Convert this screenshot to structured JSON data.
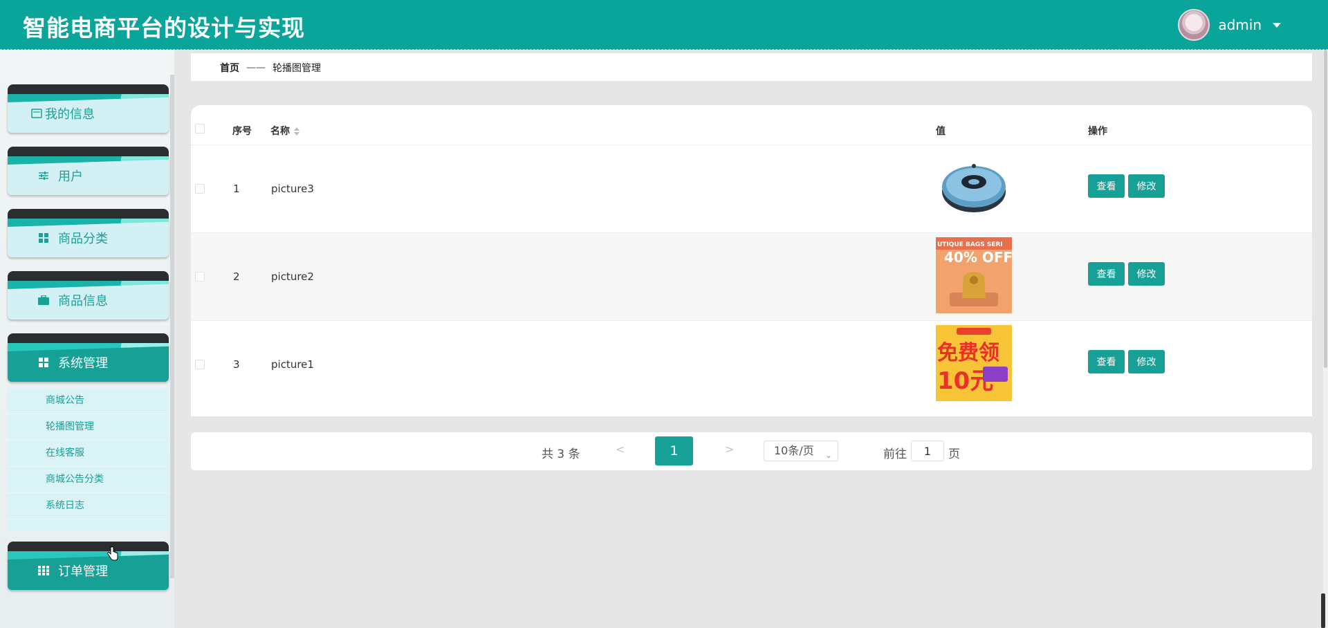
{
  "header": {
    "title": "智能电商平台的设计与实现",
    "username": "admin"
  },
  "sidebar": {
    "items": [
      {
        "label": "我的信息",
        "icon": "id-card-icon"
      },
      {
        "label": "用户",
        "icon": "sliders-icon"
      },
      {
        "label": "商品分类",
        "icon": "grid-icon"
      },
      {
        "label": "商品信息",
        "icon": "briefcase-icon"
      },
      {
        "label": "系统管理",
        "icon": "grid-icon",
        "active": true
      },
      {
        "label": "订单管理",
        "icon": "table-icon"
      }
    ],
    "submenu": [
      "商城公告",
      "轮播图管理",
      "在线客服",
      "商城公告分类",
      "系统日志"
    ]
  },
  "breadcrumb": {
    "home": "首页",
    "separator": "——",
    "current": "轮播图管理"
  },
  "table": {
    "headers": {
      "index": "序号",
      "name": "名称",
      "value": "值",
      "actions": "操作"
    },
    "rows": [
      {
        "index": "1",
        "name": "picture3",
        "image": "robot-vacuum"
      },
      {
        "index": "2",
        "name": "picture2",
        "image": "bag-sale-banner"
      },
      {
        "index": "3",
        "name": "picture1",
        "image": "promo-banner"
      }
    ],
    "view_label": "查看",
    "edit_label": "修改"
  },
  "image_text": {
    "bags_series": "UTIQUE BAGS SERI",
    "sale": "40% OFF",
    "promo_big": "免费领",
    "promo_num": "10元"
  },
  "pagination": {
    "total": "共 3 条",
    "prev": "<",
    "page": "1",
    "next": ">",
    "page_size": "10条/页",
    "goto_label": "前往",
    "goto_value": "1",
    "goto_suffix": "页"
  },
  "colors": {
    "primary": "#16a096",
    "header": "#0aa59a",
    "submenu_bg": "#d9f3f6"
  }
}
